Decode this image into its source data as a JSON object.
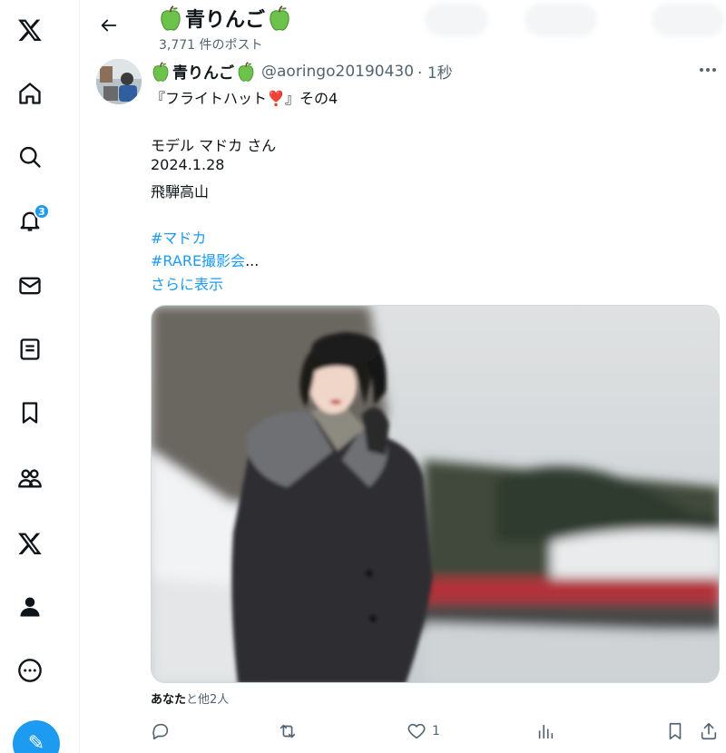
{
  "nav": {
    "items": [
      {
        "icon": "x-logo-icon"
      },
      {
        "icon": "home-icon"
      },
      {
        "icon": "search-icon"
      },
      {
        "icon": "bell-icon",
        "badge": "3"
      },
      {
        "icon": "mail-icon"
      },
      {
        "icon": "list-icon"
      },
      {
        "icon": "bookmark-icon"
      },
      {
        "icon": "communities-icon"
      },
      {
        "icon": "x-premium-icon"
      },
      {
        "icon": "profile-icon"
      },
      {
        "icon": "more-circle-icon"
      }
    ],
    "compose_icon": "compose-icon"
  },
  "header": {
    "title": "青りんご",
    "post_count": "3,771 件のポスト"
  },
  "tweet": {
    "author_name": "青りんご",
    "handle": "@aoringo20190430",
    "time": "· 1秒",
    "lines": {
      "title_before": "『フライトハット",
      "title_emoji": "❣️",
      "title_after": "』その4",
      "model": "モデル マドカ さん",
      "date": "2024.1.28",
      "place": "飛騨高山"
    },
    "hashtag1": "#マドカ",
    "hashtag2": "#RARE撮影会",
    "ellipsis": "...",
    "show_more": "さらに表示",
    "liked_by_bold": "あなた",
    "liked_by_rest": "と他2人",
    "actions": {
      "reply_count": "",
      "retweet_count": "",
      "like_count": "1",
      "views_count": ""
    }
  },
  "colors": {
    "accent": "#1d9bf0",
    "text_secondary": "#536471",
    "border": "#eff3f4"
  }
}
